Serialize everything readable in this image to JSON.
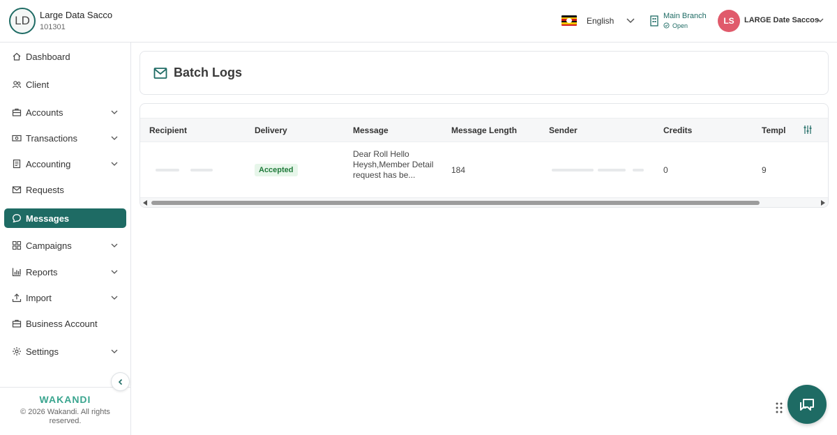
{
  "org": {
    "initials": "LD",
    "name": "Large Data Sacco",
    "code": "101301"
  },
  "header": {
    "language": "English",
    "branch": {
      "name": "Main Branch",
      "status": "Open"
    },
    "user": {
      "initials": "LS",
      "name": "LARGE Date Saccos"
    },
    "colors": {
      "accent": "#1e6b64",
      "user_avatar": "#e05a6b"
    }
  },
  "sidebar": {
    "items": [
      {
        "label": "Dashboard",
        "icon": "home-icon"
      },
      {
        "label": "Client",
        "icon": "users-icon"
      },
      {
        "label": "Accounts",
        "icon": "briefcase-icon"
      },
      {
        "label": "Transactions",
        "icon": "cash-icon"
      },
      {
        "label": "Accounting",
        "icon": "ledger-icon"
      },
      {
        "label": "Requests",
        "icon": "envelope-icon"
      },
      {
        "label": "Messages",
        "icon": "chat-icon",
        "active": true
      },
      {
        "label": "Campaigns",
        "icon": "grid-icon"
      },
      {
        "label": "Reports",
        "icon": "bar-chart-icon"
      },
      {
        "label": "Import",
        "icon": "upload-icon"
      },
      {
        "label": "Business Account",
        "icon": "briefcase-icon"
      },
      {
        "label": "Settings",
        "icon": "gear-icon"
      }
    ],
    "brand": "WAKANDI",
    "copyright": "© 2026 Wakandi. All rights reserved."
  },
  "page": {
    "title": "Batch Logs"
  },
  "table": {
    "columns": [
      "Recipient",
      "Delivery",
      "Message",
      "Message Length",
      "Sender",
      "Credits",
      "Templ"
    ],
    "rows": [
      {
        "delivery": "Accepted",
        "message": "Dear Roll Hello Heysh,Member Detail request has be...",
        "message_length": "184",
        "credits": "0",
        "template": "9"
      }
    ]
  }
}
